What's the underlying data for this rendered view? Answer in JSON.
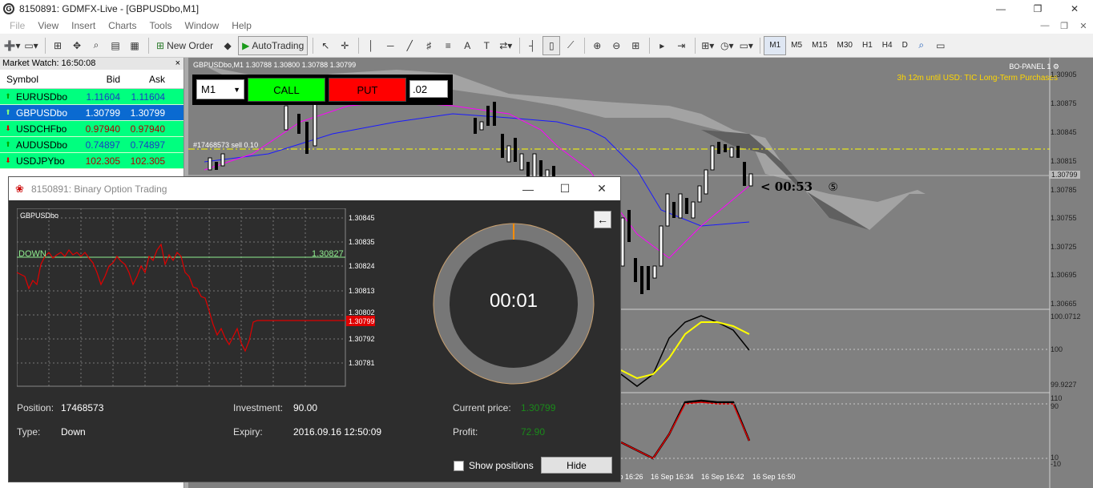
{
  "window": {
    "title": "8150891: GDMFX-Live - [GBPUSDbo,M1]",
    "min": "—",
    "max": "❐",
    "close": "✕"
  },
  "menu": [
    "File",
    "View",
    "Insert",
    "Charts",
    "Tools",
    "Window",
    "Help"
  ],
  "mdi": {
    "min": "—",
    "max": "❐",
    "close": "✕"
  },
  "toolbar": {
    "new_order": "New Order",
    "autotrading": "AutoTrading",
    "timeframes": [
      "M1",
      "M5",
      "M15",
      "M30",
      "H1",
      "H4",
      "D"
    ]
  },
  "market_watch": {
    "title": "Market Watch: 16:50:08",
    "close": "×",
    "headers": {
      "symbol": "Symbol",
      "bid": "Bid",
      "ask": "Ask"
    },
    "rows": [
      {
        "symbol": "EURUSDbo",
        "bid": "1.11604",
        "ask": "1.11604",
        "dir": "up"
      },
      {
        "symbol": "GBPUSDbo",
        "bid": "1.30799",
        "ask": "1.30799",
        "dir": "up",
        "selected": true
      },
      {
        "symbol": "USDCHFbo",
        "bid": "0.97940",
        "ask": "0.97940",
        "dir": "down"
      },
      {
        "symbol": "AUDUSDbo",
        "bid": "0.74897",
        "ask": "0.74897",
        "dir": "up"
      },
      {
        "symbol": "USDJPYbo",
        "bid": "102.305",
        "ask": "102.305",
        "dir": "down"
      }
    ]
  },
  "chart": {
    "header": "GBPUSDbo,M1  1.30788 1.30800 1.30788 1.30799",
    "bo_panel": "BO-PANEL 1",
    "tic_text": "3h 12m until USD: TIC Long-Term Purchases",
    "order_label": "#17468573 sell 0.10",
    "countdown": "< 00:53",
    "countdown_icon": "⑤",
    "price_labels": [
      "1.30905",
      "1.30875",
      "1.30845",
      "1.30815",
      "1.30785",
      "1.30755",
      "1.30725",
      "1.30695",
      "1.30665"
    ],
    "current_price": "1.30799",
    "ind1_labels": [
      "100.0712",
      "100",
      "99.9227"
    ],
    "ind2_labels": [
      "110",
      "90",
      "10",
      "-10"
    ],
    "time_labels": [
      "16 Sep 16:26",
      "16 Sep 16:34",
      "16 Sep 16:42",
      "16 Sep 16:50"
    ],
    "colors": {
      "cloud": "#a0a0a0",
      "kijun": "#1a1aff",
      "tenkan": "#ff00ff",
      "level": "#ffff00",
      "stoch_main": "#000000",
      "stoch_signal": "#ffff00",
      "rsi": "#e00000"
    }
  },
  "trade_panel": {
    "timeframe": "M1",
    "call": "CALL",
    "put": "PUT",
    "amount": ".02"
  },
  "dialog": {
    "title": "8150891: Binary Option Trading",
    "symbol": "GBPUSDbo",
    "direction_label": "DOWN",
    "open_price": "1.30827",
    "current_label": "1.30799",
    "price_axis": [
      "1.30845",
      "1.30835",
      "1.30824",
      "1.30813",
      "1.30802",
      "1.30792",
      "1.30781"
    ],
    "timer": "00:01",
    "back_icon": "⊕",
    "position_label": "Position:",
    "position": "17468573",
    "type_label": "Type:",
    "type": "Down",
    "investment_label": "Investment:",
    "investment": "90.00",
    "expiry_label": "Expiry:",
    "expiry": "2016.09.16 12:50:09",
    "current_price_label": "Current price:",
    "current_price": "1.30799",
    "profit_label": "Profit:",
    "profit": "72.90",
    "show_positions": "Show positions",
    "hide": "Hide"
  }
}
